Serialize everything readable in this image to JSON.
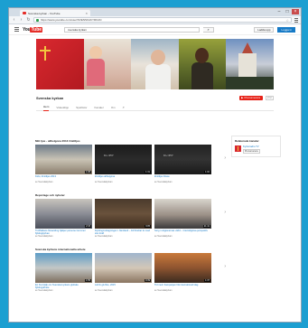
{
  "browser": {
    "tab_title": "Svenska kyrkan - YouTube",
    "url": "https://www.youtube.com/user/SVENSKAKYRKAN"
  },
  "youtube": {
    "logo_you": "You",
    "logo_tube": "Tube",
    "search_value": "svenska kyrkan",
    "upload_label": "Ladda upp",
    "signin_label": "Logga in"
  },
  "channel": {
    "name": "Svenska kyrkan",
    "subscribe_label": "Prenumerera",
    "subscriber_count": "2 tn",
    "tabs": [
      "Hem",
      "Videoklipp",
      "Spellistor",
      "Kanaler",
      "Om"
    ]
  },
  "sections": [
    {
      "title": "Mitt ljus - allhelgona 2013 #mittljus",
      "videos": [
        {
          "title": "Kicki, #mittljus 2013",
          "meta1": "av Svenskakyrkan",
          "meta2": "587 visningar • för 1 år sedan",
          "duration": "1:08"
        },
        {
          "title": "#mittljus allhelgona",
          "meta1": "av Svenskakyrkan",
          "meta2": "10 215 visningar • för 1 år sedan",
          "duration": "1:31"
        },
        {
          "title": "#mittljus Nisse",
          "meta1": "av Svenskakyrkan",
          "meta2": "1 172 visningar • för 1 år sedan",
          "duration": "1:02"
        }
      ]
    },
    {
      "title": "Reportage och nyheter",
      "videos": [
        {
          "title": "Trollhättans församling hjälper personer kommer flyktingkyrkan",
          "meta1": "av Svenskakyrkan",
          "meta2": "1 059 visningar • för 1 år sedan",
          "duration": "2:33"
        },
        {
          "title": "Flyktingmottagningen i Jämtland – Förhindrar liv med stor kraft",
          "meta1": "av Svenskakyrkan",
          "meta2": "411 visningar • för 1 år sedan",
          "duration": "3:05"
        },
        {
          "title": "Sorg i religionernas värld – Interreligiösa perspektiv",
          "meta1": "av Svenskakyrkan",
          "meta2": "1 072 visningar • för 1 år sedan",
          "duration": "21:41"
        }
      ]
    },
    {
      "title": "Svenska kyrkans internationella arbete",
      "videos": [
        {
          "title": "En bra hjälp om Svenska kyrkans globala flyktingarbete",
          "meta1": "av Svenskakyrkan",
          "meta2": "1 014 visningar",
          "duration": "1:55"
        },
        {
          "title": "Låt liv gå före, 2015",
          "meta1": "av Svenskakyrkan",
          "meta2": "672 visningar",
          "duration": "0:39"
        },
        {
          "title": "Tid med: Kampanjen Nä internationell dag",
          "meta1": "av Svenskakyrkan",
          "meta2": "288 visningar",
          "duration": "1:37"
        }
      ]
    }
  ],
  "sidebar": {
    "title": "Relaterade kanaler",
    "channel_name": "Kyrkoradio TV",
    "channel_button": "Prenumerera"
  },
  "thumbnail_text": {
    "clips": "KLIPP"
  }
}
